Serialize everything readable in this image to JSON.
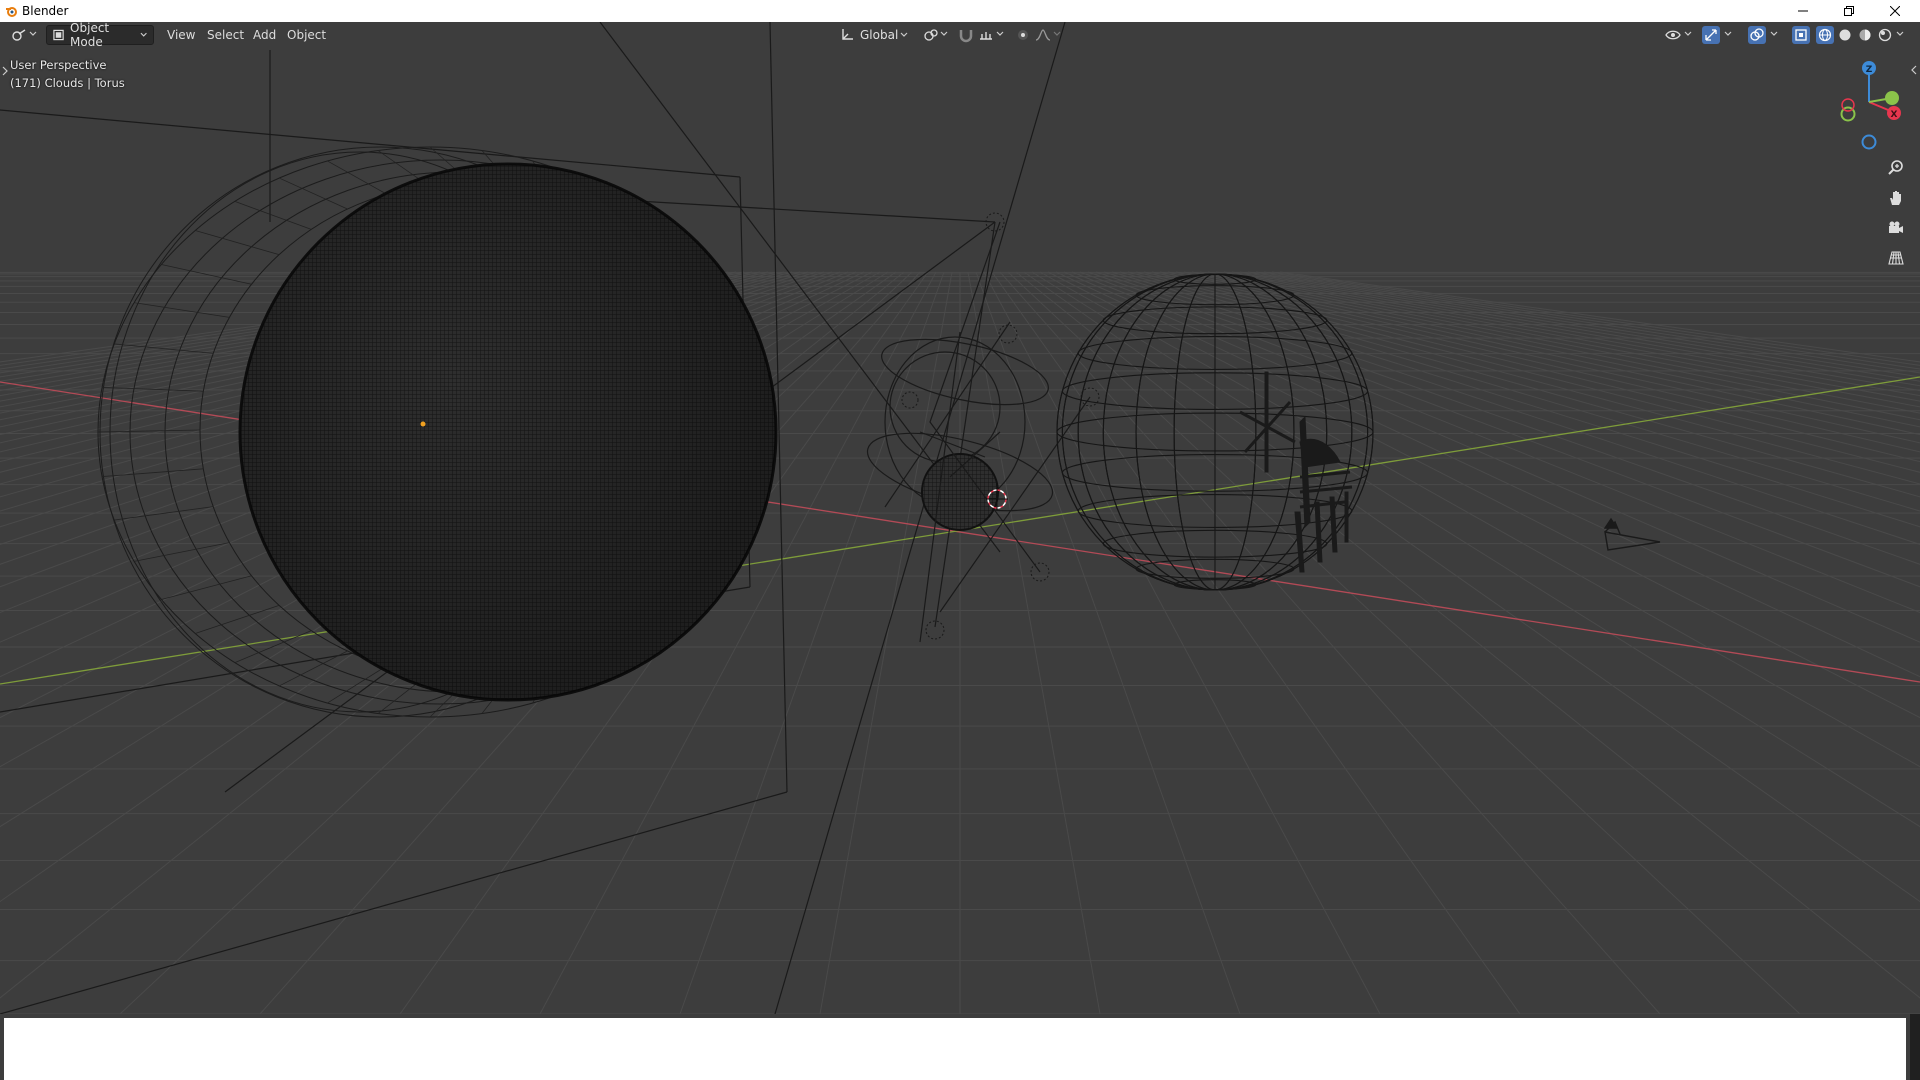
{
  "window": {
    "title": "Blender",
    "controls": [
      "minimize",
      "restore",
      "close"
    ]
  },
  "header": {
    "mode": "Object Mode",
    "menus": [
      "View",
      "Select",
      "Add",
      "Object"
    ],
    "orientation": "Global"
  },
  "viewport": {
    "perspective_label": "User Perspective",
    "object_info": "(171) Clouds | Torus"
  },
  "gizmo": {
    "axes": [
      "Z",
      "X",
      "Y"
    ],
    "colors": {
      "x": "#e8364e",
      "y": "#8bc34a",
      "z": "#3d8bd8"
    }
  },
  "navigation_icons": [
    "zoom-icon",
    "hand-pan-icon",
    "camera-icon",
    "grid-icon"
  ],
  "colors": {
    "viewport_bg": "#3d3d3d",
    "header_bg": "#3d3d3d",
    "x_axis": "#b34a56",
    "y_axis": "#7e9c3a",
    "wire": "#111111",
    "cursor": "#e8364e"
  }
}
